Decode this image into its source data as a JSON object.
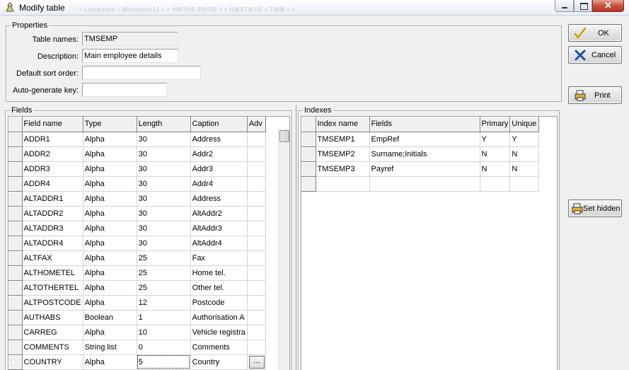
{
  "window": {
    "title": "Modify table",
    "background_tabs": "▪ Lomquote ▪ Windows/11 ▪ ▪ HMTHE.PROD ▪ ▪ HMSTMYE ▪ TMM ▪ ▪"
  },
  "properties": {
    "legend": "Properties",
    "table_names_label": "Table names:",
    "table_names_value": "TMSEMP",
    "description_label": "Description:",
    "description_value": "Main employee details",
    "sort_order_label": "Default sort order:",
    "sort_order_value": "",
    "auto_key_label": "Auto-generate key:",
    "auto_key_value": ""
  },
  "fields": {
    "legend": "Fields",
    "columns": [
      "Field name",
      "Type",
      "Length",
      "Caption",
      "Adv"
    ],
    "rows": [
      [
        "ADDR1",
        "Alpha",
        "30",
        "Address",
        ""
      ],
      [
        "ADDR2",
        "Alpha",
        "30",
        "Addr2",
        ""
      ],
      [
        "ADDR3",
        "Alpha",
        "30",
        "Addr3",
        ""
      ],
      [
        "ADDR4",
        "Alpha",
        "30",
        "Addr4",
        ""
      ],
      [
        "ALTADDR1",
        "Alpha",
        "30",
        "Address",
        ""
      ],
      [
        "ALTADDR2",
        "Alpha",
        "30",
        "AltAddr2",
        ""
      ],
      [
        "ALTADDR3",
        "Alpha",
        "30",
        "AltAddr3",
        ""
      ],
      [
        "ALTADDR4",
        "Alpha",
        "30",
        "AltAddr4",
        ""
      ],
      [
        "ALTFAX",
        "Alpha",
        "25",
        "Fax",
        ""
      ],
      [
        "ALTHOMETEL",
        "Alpha",
        "25",
        "Home tel.",
        ""
      ],
      [
        "ALTOTHERTEL",
        "Alpha",
        "25",
        "Other tel.",
        ""
      ],
      [
        "ALTPOSTCODE",
        "Alpha",
        "12",
        "Postcode",
        ""
      ],
      [
        "AUTHABS",
        "Boolean",
        "1",
        "Authorisation A",
        ""
      ],
      [
        "CARREG",
        "Alpha",
        "10",
        "Vehicle registra",
        ""
      ],
      [
        "COMMENTS",
        "String list",
        "0",
        "Comments",
        ""
      ],
      [
        "COUNTRY",
        "Alpha",
        "5",
        "Country",
        "..."
      ]
    ]
  },
  "indexes": {
    "legend": "Indexes",
    "columns": [
      "Index name",
      "Fields",
      "Primary",
      "Unique"
    ],
    "rows": [
      [
        "TMSEMP1",
        "EmpRef",
        "Y",
        "Y"
      ],
      [
        "TMSEMP2",
        "Surname;Initials",
        "N",
        "N"
      ],
      [
        "TMSEMP3",
        "Payref",
        "N",
        "N"
      ],
      [
        "",
        "",
        "",
        ""
      ]
    ]
  },
  "buttons": {
    "ok": "OK",
    "cancel": "Cancel",
    "print": "Print",
    "set_hidden": "Set hidden"
  },
  "colors": {
    "ok_check": "#c8a000",
    "cancel_x": "#1f4ea3",
    "print_icon": "#e0b030"
  }
}
